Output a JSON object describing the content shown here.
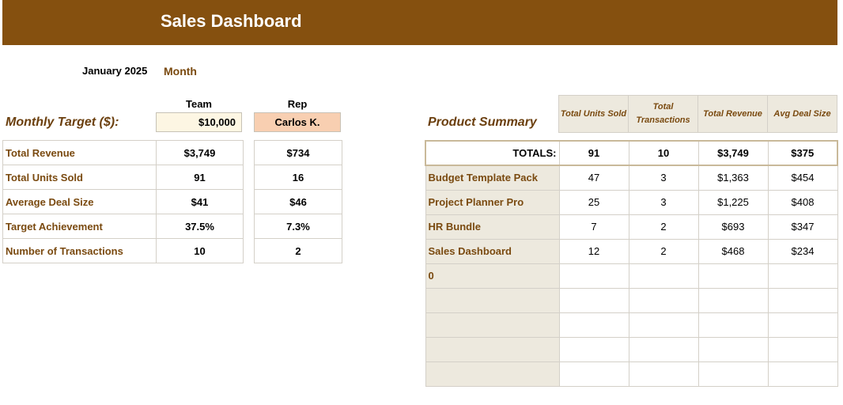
{
  "header": {
    "title": "Sales Dashboard"
  },
  "period": {
    "date": "January 2025",
    "label": "Month"
  },
  "kpi": {
    "team_header": "Team",
    "rep_header": "Rep",
    "target_label": "Monthly Target ($):",
    "team_target": "$10,000",
    "rep_name": "Carlos K.",
    "rows": [
      {
        "label": "Total Revenue",
        "team": "$3,749",
        "rep": "$734"
      },
      {
        "label": "Total Units Sold",
        "team": "91",
        "rep": "16"
      },
      {
        "label": "Average Deal Size",
        "team": "$41",
        "rep": "$46"
      },
      {
        "label": "Target Achievement",
        "team": "37.5%",
        "rep": "7.3%"
      },
      {
        "label": "Number of Transactions",
        "team": "10",
        "rep": "2"
      }
    ]
  },
  "product_summary": {
    "title": "Product Summary",
    "columns": [
      "Total Units Sold",
      "Total Transactions",
      "Total Revenue",
      "Avg Deal Size"
    ],
    "totals": {
      "label": "TOTALS:",
      "units": "91",
      "transactions": "10",
      "revenue": "$3,749",
      "avg": "$375"
    },
    "rows": [
      {
        "name": "Budget Template Pack",
        "units": "47",
        "transactions": "3",
        "revenue": "$1,363",
        "avg": "$454"
      },
      {
        "name": "Project Planner Pro",
        "units": "25",
        "transactions": "3",
        "revenue": "$1,225",
        "avg": "$408"
      },
      {
        "name": "HR Bundle",
        "units": "7",
        "transactions": "2",
        "revenue": "$693",
        "avg": "$347"
      },
      {
        "name": "Sales Dashboard",
        "units": "12",
        "transactions": "2",
        "revenue": "$468",
        "avg": "$234"
      },
      {
        "name": "0",
        "units": "",
        "transactions": "",
        "revenue": "",
        "avg": ""
      },
      {
        "name": "",
        "units": "",
        "transactions": "",
        "revenue": "",
        "avg": ""
      },
      {
        "name": "",
        "units": "",
        "transactions": "",
        "revenue": "",
        "avg": ""
      },
      {
        "name": "",
        "units": "",
        "transactions": "",
        "revenue": "",
        "avg": ""
      },
      {
        "name": "",
        "units": "",
        "transactions": "",
        "revenue": "",
        "avg": ""
      }
    ]
  }
}
